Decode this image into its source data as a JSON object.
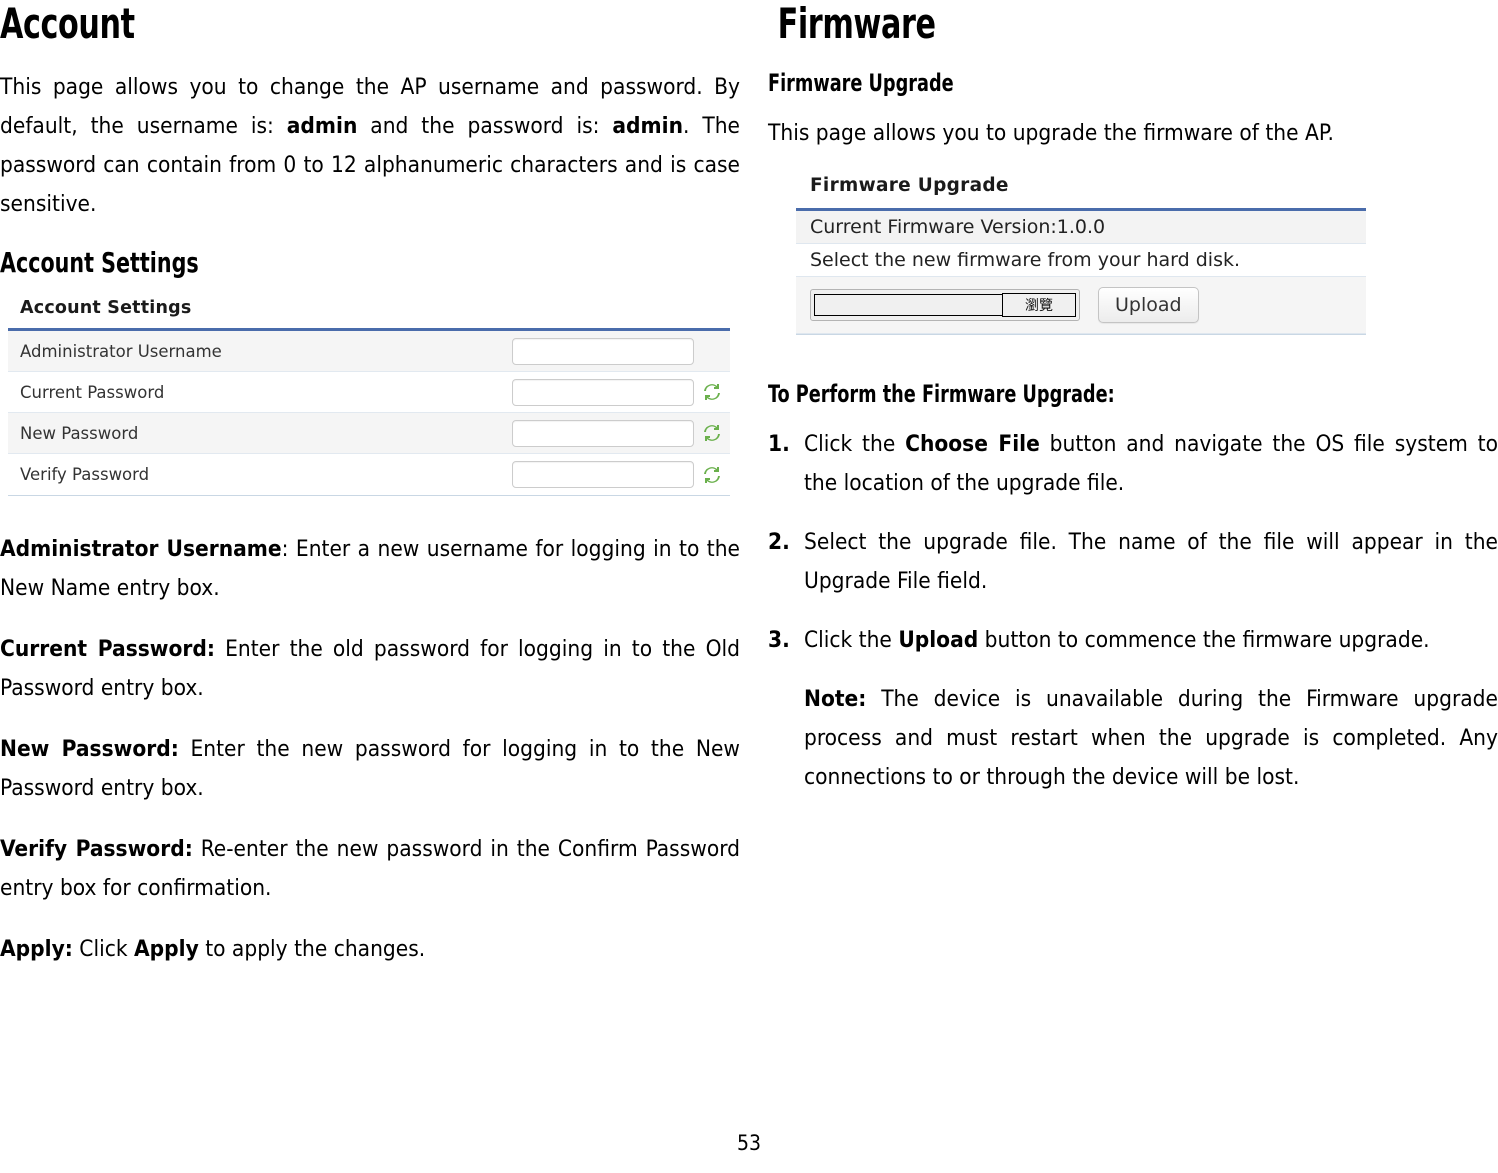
{
  "page": {
    "folio": "53"
  },
  "left": {
    "chapter_title": "Account",
    "intro": {
      "t1": "This page allows you to change the AP username and password. By default, the username is: ",
      "b1": "admin",
      "t2": " and the password is: ",
      "b2": "admin",
      "t3": ". The password can contain from 0 to 12 alphanumeric characters and is case sensitive."
    },
    "section_title": "Account Settings",
    "screenshot": {
      "panel_title": "Account Settings",
      "rows": [
        {
          "label": "Administrator Username",
          "has_refresh": false
        },
        {
          "label": "Current Password",
          "has_refresh": true
        },
        {
          "label": "New Password",
          "has_refresh": true
        },
        {
          "label": "Verify Password",
          "has_refresh": true
        }
      ],
      "input_value": "",
      "refresh_icon": "refresh-icon"
    },
    "definitions": [
      {
        "term": "Administrator Username",
        "sep": ": ",
        "desc": "Enter a new username for logging in to the New Name entry box."
      },
      {
        "term": "Current Password:",
        "sep": " ",
        "desc": "Enter the old password for logging in to the Old Password entry box."
      },
      {
        "term": "New Password:",
        "sep": " ",
        "desc": "Enter the new password for logging in to the New Password entry box."
      },
      {
        "term": "Verify Password:",
        "sep": " ",
        "desc": "Re-enter the new password in the Confirm Password entry box for confirmation."
      }
    ],
    "apply": {
      "term": "Apply:",
      "pre": " Click ",
      "bold": "Apply",
      "post": " to apply the changes."
    }
  },
  "right": {
    "chapter_title": "Firmware",
    "section_title": "Firmware Upgrade",
    "intro": "This page allows you to upgrade the firmware of the AP.",
    "screenshot": {
      "panel_title": "Firmware Upgrade",
      "current_version_row": "Current Firmware Version:1.0.0",
      "select_row": "Select the new firmware from your hard disk.",
      "file_value": "",
      "browse_label": "瀏覽",
      "upload_label": "Upload"
    },
    "steps_heading": "To Perform the Firmware Upgrade:",
    "steps": [
      {
        "num": "1.",
        "pre": "Click the ",
        "bold": "Choose File",
        "post": " button and navigate the OS file system to the location of the upgrade file."
      },
      {
        "num": "2.",
        "pre": "Select the upgrade file. The name of the file will appear in the Upgrade File field.",
        "bold": "",
        "post": ""
      },
      {
        "num": "3.",
        "pre": "Click the ",
        "bold": "Upload",
        "post": " button to commence the firmware upgrade."
      }
    ],
    "note": {
      "label": "Note:",
      "text": " The device is unavailable during the Firmware upgrade process and must restart when the upgrade is completed. Any connections to or through the device will be lost."
    }
  },
  "colors": {
    "panel_accent": "#4a6cab",
    "row_alt": "#f5f5f5",
    "refresh_green": "#6ab04c"
  }
}
